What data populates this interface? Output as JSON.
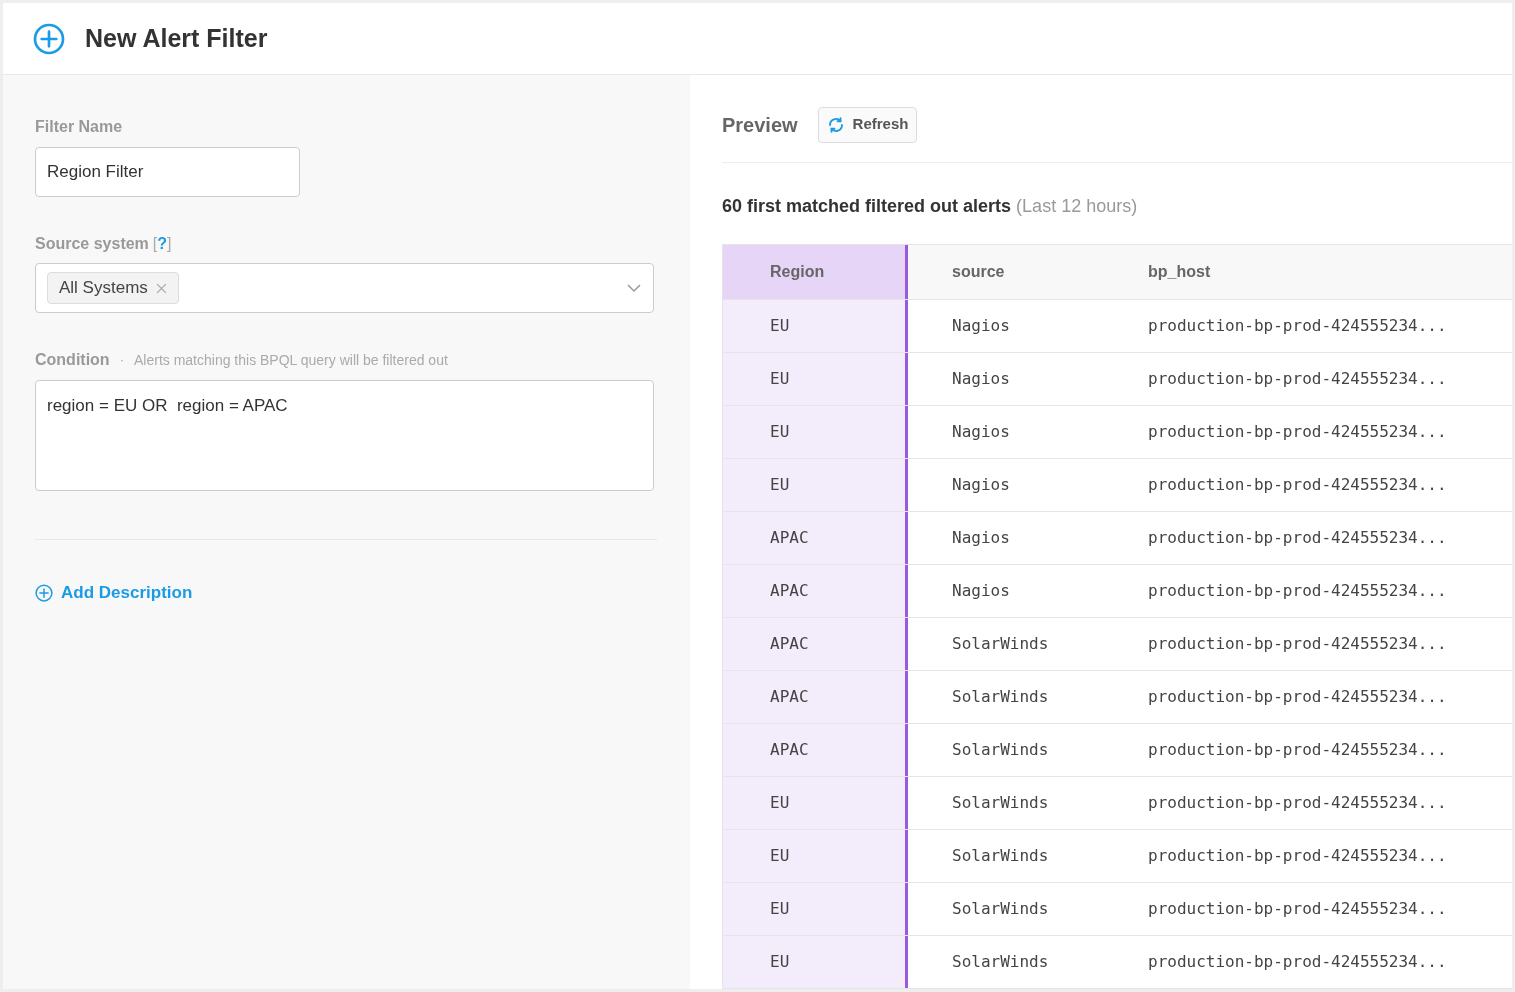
{
  "header": {
    "title": "New Alert Filter"
  },
  "form": {
    "filter_name": {
      "label": "Filter Name",
      "value": "Region Filter"
    },
    "source_system": {
      "label": "Source system",
      "help_open": "[",
      "help": "?",
      "help_close": "]",
      "tags": [
        "All Systems"
      ]
    },
    "condition": {
      "label": "Condition",
      "separator": "·",
      "hint": "Alerts matching this BPQL query will be filtered out",
      "value": "region = EU OR  region = APAC"
    },
    "add_description": "Add Description"
  },
  "preview": {
    "title": "Preview",
    "refresh_button": "Refresh",
    "summary": "60 first matched filtered out alerts",
    "period": "(Last 12 hours)",
    "table": {
      "columns": [
        {
          "label": "Region",
          "selected": true
        },
        {
          "label": "source",
          "selected": false
        },
        {
          "label": "bp_host",
          "selected": false
        }
      ],
      "rows": [
        [
          "EU",
          "Nagios",
          "production-bp-prod-424555234..."
        ],
        [
          "EU",
          "Nagios",
          "production-bp-prod-424555234..."
        ],
        [
          "EU",
          "Nagios",
          "production-bp-prod-424555234..."
        ],
        [
          "EU",
          "Nagios",
          "production-bp-prod-424555234..."
        ],
        [
          "APAC",
          "Nagios",
          "production-bp-prod-424555234..."
        ],
        [
          "APAC",
          "Nagios",
          "production-bp-prod-424555234..."
        ],
        [
          "APAC",
          "SolarWinds",
          "production-bp-prod-424555234..."
        ],
        [
          "APAC",
          "SolarWinds",
          "production-bp-prod-424555234..."
        ],
        [
          "APAC",
          "SolarWinds",
          "production-bp-prod-424555234..."
        ],
        [
          "EU",
          "SolarWinds",
          "production-bp-prod-424555234..."
        ],
        [
          "EU",
          "SolarWinds",
          "production-bp-prod-424555234..."
        ],
        [
          "EU",
          "SolarWinds",
          "production-bp-prod-424555234..."
        ],
        [
          "EU",
          "SolarWinds",
          "production-bp-prod-424555234..."
        ]
      ]
    }
  }
}
